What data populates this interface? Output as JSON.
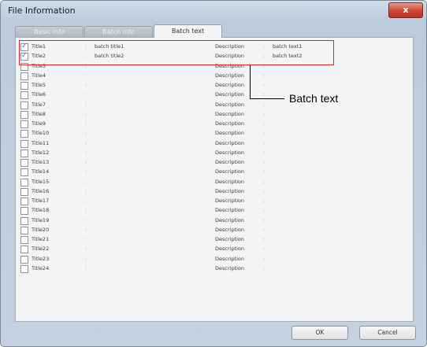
{
  "window": {
    "title": "File Information",
    "close_glyph": "x"
  },
  "tabs": [
    {
      "label": "Basic info",
      "active": false
    },
    {
      "label": "Batch info",
      "active": false
    },
    {
      "label": "Batch text",
      "active": true
    }
  ],
  "separator": ":",
  "description_label": "Description",
  "rows": [
    {
      "title": "Title1",
      "checked": true,
      "title_value": "batch title1",
      "desc_value": "batch text1"
    },
    {
      "title": "Title2",
      "checked": true,
      "title_value": "batch title2",
      "desc_value": "batch text2"
    },
    {
      "title": "Title3",
      "checked": false,
      "title_value": "",
      "desc_value": ""
    },
    {
      "title": "Title4",
      "checked": false,
      "title_value": "",
      "desc_value": ""
    },
    {
      "title": "Title5",
      "checked": false,
      "title_value": "",
      "desc_value": ""
    },
    {
      "title": "Title6",
      "checked": false,
      "title_value": "",
      "desc_value": ""
    },
    {
      "title": "Title7",
      "checked": false,
      "title_value": "",
      "desc_value": ""
    },
    {
      "title": "Title8",
      "checked": false,
      "title_value": "",
      "desc_value": ""
    },
    {
      "title": "Title9",
      "checked": false,
      "title_value": "",
      "desc_value": ""
    },
    {
      "title": "Title10",
      "checked": false,
      "title_value": "",
      "desc_value": ""
    },
    {
      "title": "Title11",
      "checked": false,
      "title_value": "",
      "desc_value": ""
    },
    {
      "title": "Title12",
      "checked": false,
      "title_value": "",
      "desc_value": ""
    },
    {
      "title": "Title13",
      "checked": false,
      "title_value": "",
      "desc_value": ""
    },
    {
      "title": "Title14",
      "checked": false,
      "title_value": "",
      "desc_value": ""
    },
    {
      "title": "Title15",
      "checked": false,
      "title_value": "",
      "desc_value": ""
    },
    {
      "title": "Title16",
      "checked": false,
      "title_value": "",
      "desc_value": ""
    },
    {
      "title": "Title17",
      "checked": false,
      "title_value": "",
      "desc_value": ""
    },
    {
      "title": "Title18",
      "checked": false,
      "title_value": "",
      "desc_value": ""
    },
    {
      "title": "Title19",
      "checked": false,
      "title_value": "",
      "desc_value": ""
    },
    {
      "title": "Title20",
      "checked": false,
      "title_value": "",
      "desc_value": ""
    },
    {
      "title": "Title21",
      "checked": false,
      "title_value": "",
      "desc_value": ""
    },
    {
      "title": "Title22",
      "checked": false,
      "title_value": "",
      "desc_value": ""
    },
    {
      "title": "Title23",
      "checked": false,
      "title_value": "",
      "desc_value": ""
    },
    {
      "title": "Title24",
      "checked": false,
      "title_value": "",
      "desc_value": ""
    }
  ],
  "annotation": {
    "label": "Batch text",
    "color": "#e0262b"
  },
  "buttons": {
    "ok": "OK",
    "cancel": "Cancel"
  },
  "colors": {
    "highlight_box": "#e0262b",
    "checkmark": "#2b6fd6",
    "close_button": "#cf4b3a"
  }
}
